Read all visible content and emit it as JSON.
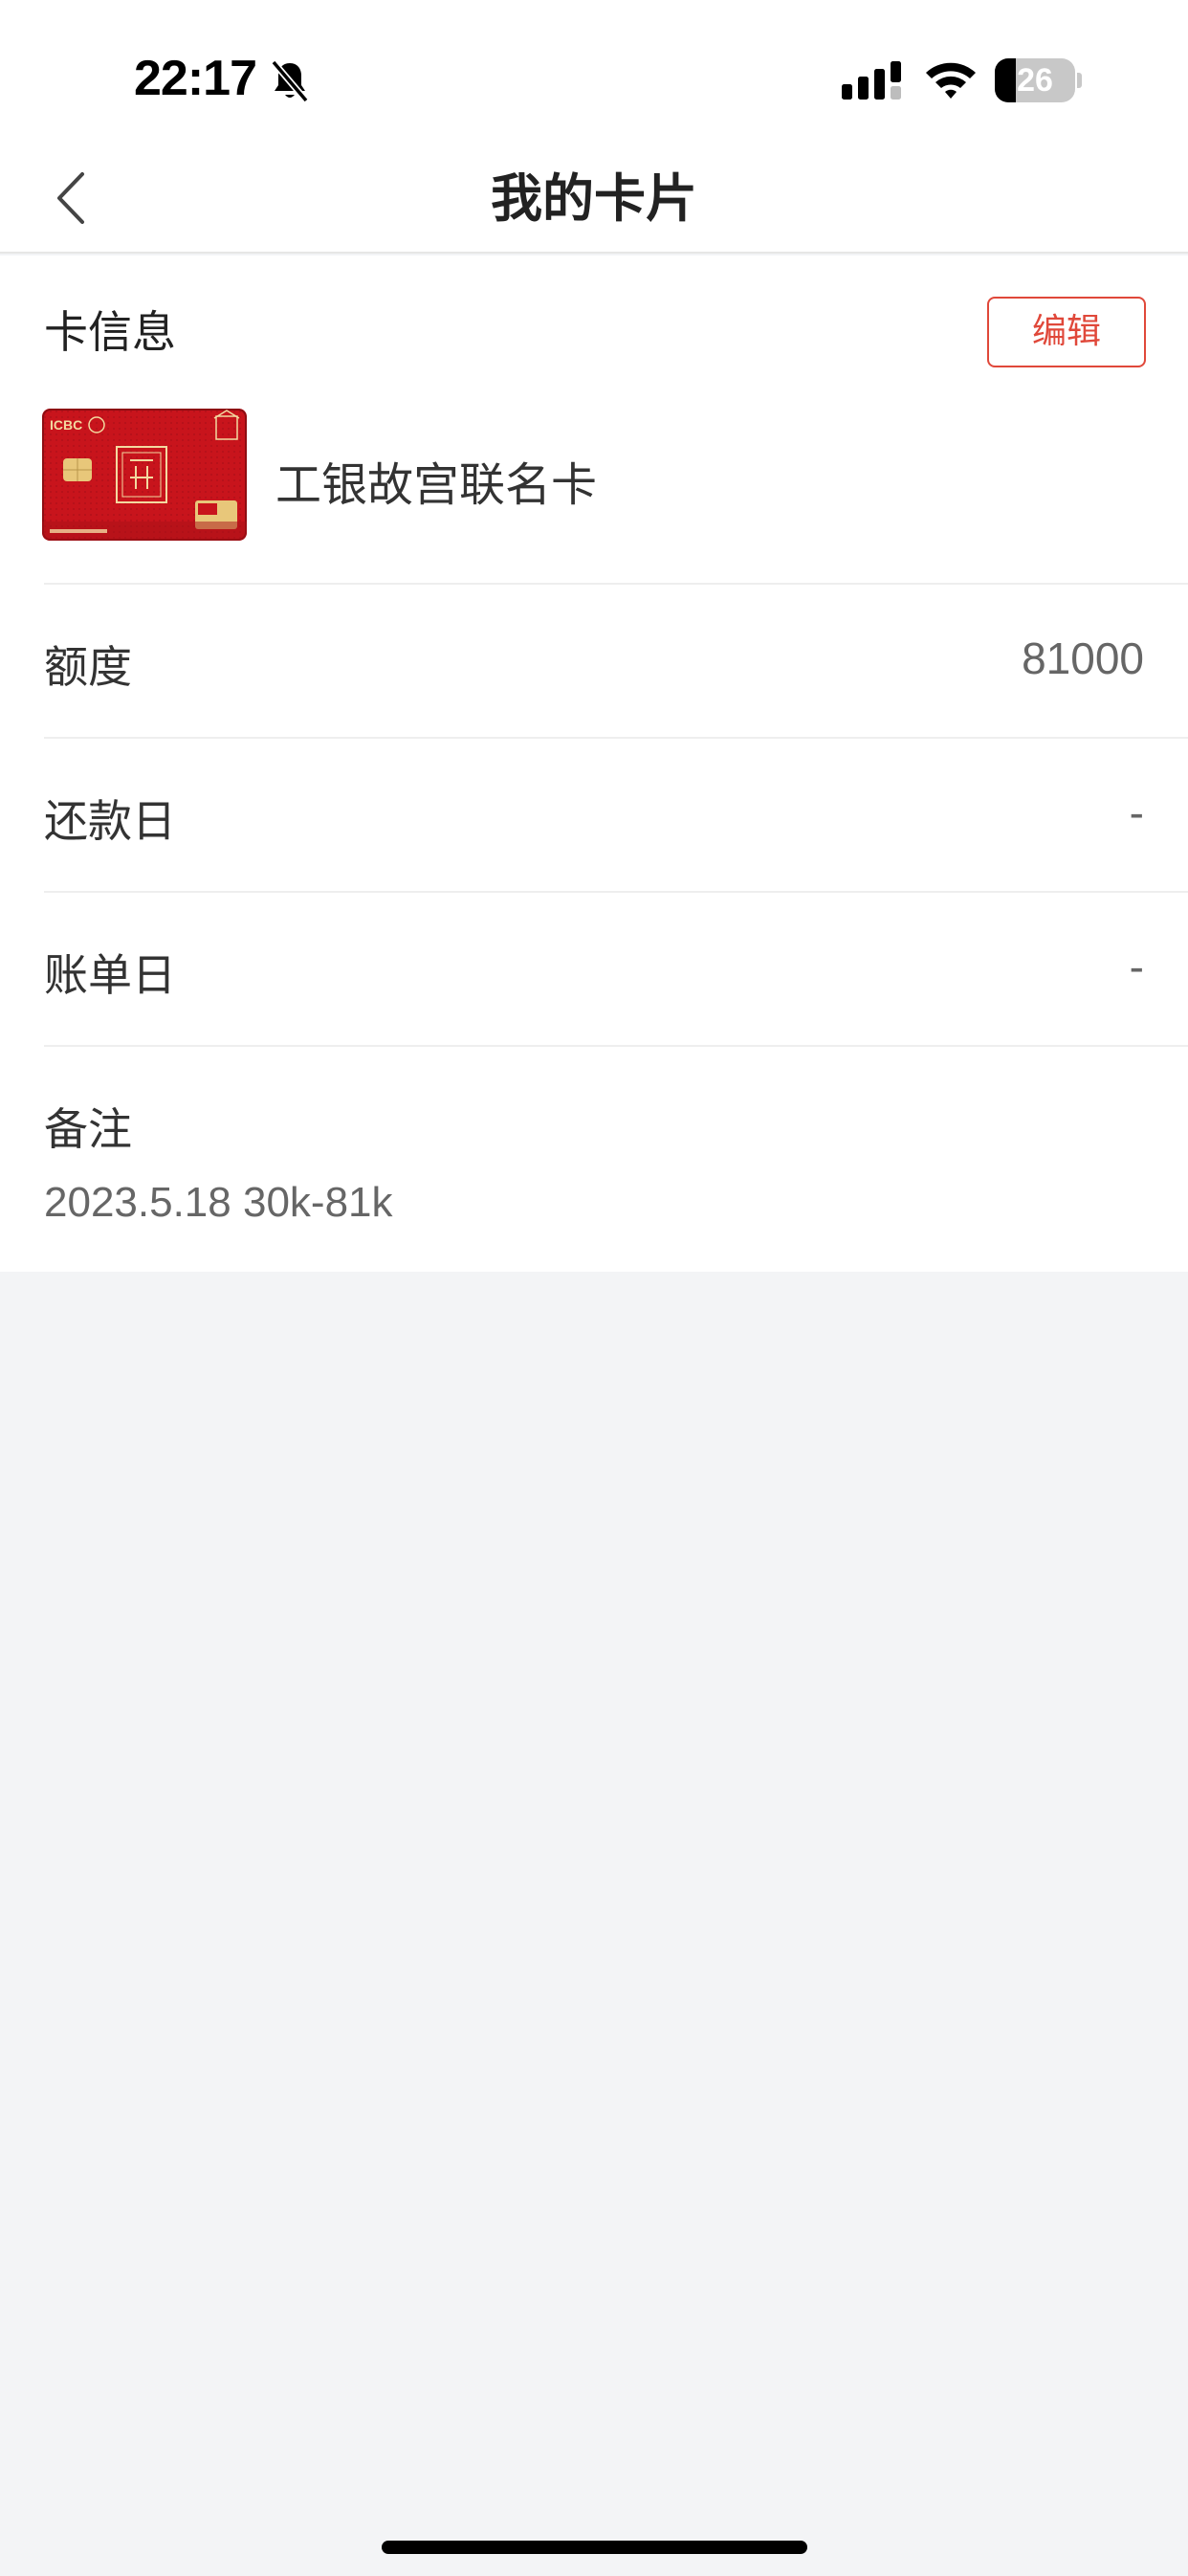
{
  "status_bar": {
    "time": "22:17",
    "battery_level": "26",
    "battery_fraction": 0.26
  },
  "nav": {
    "title": "我的卡片"
  },
  "card_info": {
    "label": "卡信息",
    "edit_label": "编辑",
    "card_name": "工银故宫联名卡",
    "thumbnail_brand": "ICBC"
  },
  "rows": [
    {
      "label": "额度",
      "value": "81000"
    },
    {
      "label": "还款日",
      "value": "-"
    },
    {
      "label": "账单日",
      "value": "-"
    }
  ],
  "note": {
    "label": "备注",
    "value": "2023.5.18 30k-81k"
  },
  "colors": {
    "accent": "#e0483a",
    "background": "#f3f4f6",
    "card_red": "#c8141c",
    "card_gold": "#e8c77a"
  },
  "icons": [
    "back-icon",
    "bell-off-icon",
    "signal-icon",
    "wifi-icon",
    "battery-icon"
  ]
}
